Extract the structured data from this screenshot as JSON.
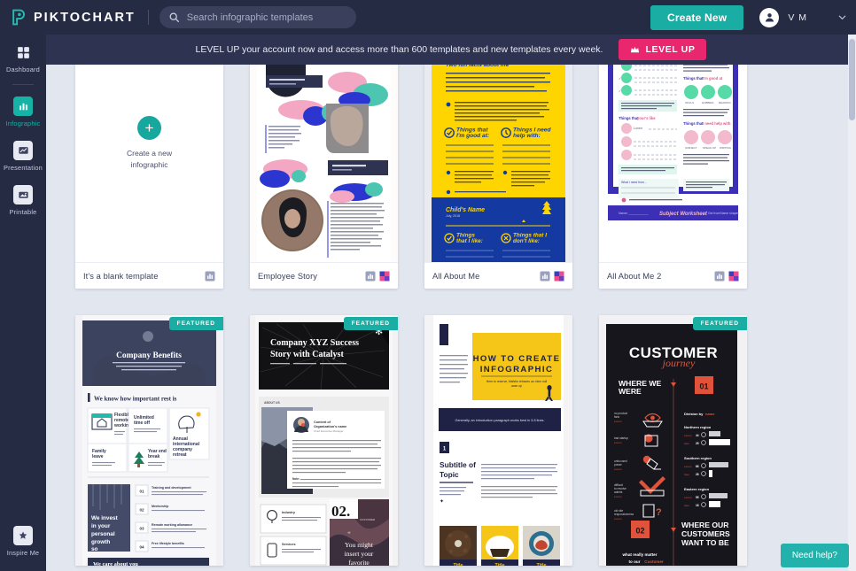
{
  "header": {
    "logo_text": "PIKTOCHART",
    "logo_icon": "piktochart-logo-icon",
    "search": {
      "placeholder": "Search infographic templates",
      "value": "",
      "icon": "search-icon"
    },
    "create_button": "Create New",
    "user_name": "V M",
    "avatar_icon": "user-avatar-icon",
    "dropdown_icon": "chevron-down-icon",
    "accent_color": "#1aada4"
  },
  "promo": {
    "text": "LEVEL UP your account now and access more than 600 templates and new templates every week.",
    "button_label": "LEVEL UP",
    "button_icon": "crown-icon",
    "button_color": "#e8276f"
  },
  "sidebar": {
    "items": [
      {
        "label": "Dashboard",
        "icon": "grid-icon",
        "active": false
      },
      {
        "label": "Infographic",
        "icon": "infographic-icon",
        "active": true
      },
      {
        "label": "Presentation",
        "icon": "presentation-icon",
        "active": false
      },
      {
        "label": "Printable",
        "icon": "printable-icon",
        "active": false
      }
    ],
    "footer_item": {
      "label": "Inspire Me",
      "icon": "star-icon"
    }
  },
  "templates": [
    {
      "title": "It's a blank template",
      "type": "blank",
      "cta_label": "Create a new\ninfographic",
      "cta_line1": "Create a new",
      "cta_line2": "infographic",
      "featured": false,
      "badges": [
        "infographic-badge"
      ]
    },
    {
      "title": "Employee Story",
      "type": "thumbnail",
      "featured": false,
      "badges": [
        "infographic-badge",
        "color-badge"
      ]
    },
    {
      "title": "All About Me",
      "type": "thumbnail",
      "featured": false,
      "badges": [
        "infographic-badge",
        "color-badge"
      ],
      "thumb_text": {
        "heading": "Two fun facts about me",
        "col1": "Things that I'm good at:",
        "col2": "Things I need help with:",
        "child_name": "Child's Name",
        "child_date": "July, 2018",
        "col3": "Things that I like:",
        "col4": "Things that I don't like:"
      }
    },
    {
      "title": "All About Me 2",
      "type": "thumbnail",
      "featured": false,
      "badges": [
        "infographic-badge",
        "color-badge"
      ]
    },
    {
      "title": "",
      "type": "thumbnail",
      "featured": true,
      "featured_label": "FEATURED",
      "badges": [],
      "thumb_text": {
        "hero": "Company Benefits",
        "section": "We know how important rest is",
        "b1": "Flexible remote working",
        "b2": "Unlimited time off",
        "b3": "Annual international company retreat",
        "b4": "Family leave",
        "b5": "Year end break",
        "side": "We invest in your personal growth",
        "items": [
          "01",
          "02",
          "03",
          "04"
        ],
        "footer": "We care about you"
      }
    },
    {
      "title": "",
      "type": "thumbnail",
      "featured": true,
      "featured_label": "FEATURED",
      "badges": [],
      "thumb_text": {
        "hero_line1": "Company XYZ Success",
        "hero_line2": "Story with Catalyst",
        "label": "ABOUT US",
        "number": "02.",
        "quote_line1": "You might",
        "quote_line2": "insert your",
        "quote_line3": "favorite",
        "item1": "Industry",
        "item2": "Services"
      }
    },
    {
      "title": "",
      "type": "thumbnail",
      "featured": false,
      "badges": [],
      "thumb_text": {
        "hero_line1": "HOW TO CREATE",
        "hero_line2": "INFOGRAPHIC",
        "banner": "Generally, an introduction paragraph works best in 3-5 lines.",
        "step": "1",
        "sub_line1": "Subtitle of",
        "sub_line2": "Topic",
        "tiles": [
          "Title",
          "Title",
          "Title"
        ]
      }
    },
    {
      "title": "",
      "type": "thumbnail",
      "featured": true,
      "featured_label": "FEATURED",
      "badges": [],
      "thumb_text": {
        "hero_line1": "CUSTOMER",
        "hero_line2": "journey",
        "left_heading_line1": "WHERE WE",
        "left_heading_line2": "WERE",
        "num1": "01",
        "num2": "02",
        "division": "Division by",
        "region1": "Northern region",
        "region2": "Southern region",
        "region3": "Eastern region",
        "right_heading_line1": "WHERE OUR",
        "right_heading_line2": "CUSTOMERS",
        "right_heading_line3": "WANT TO BE",
        "footer_line1": "what really matter",
        "footer_line2": "to our"
      }
    }
  ],
  "help": {
    "label": "Need help?",
    "color": "#23b2ab"
  }
}
